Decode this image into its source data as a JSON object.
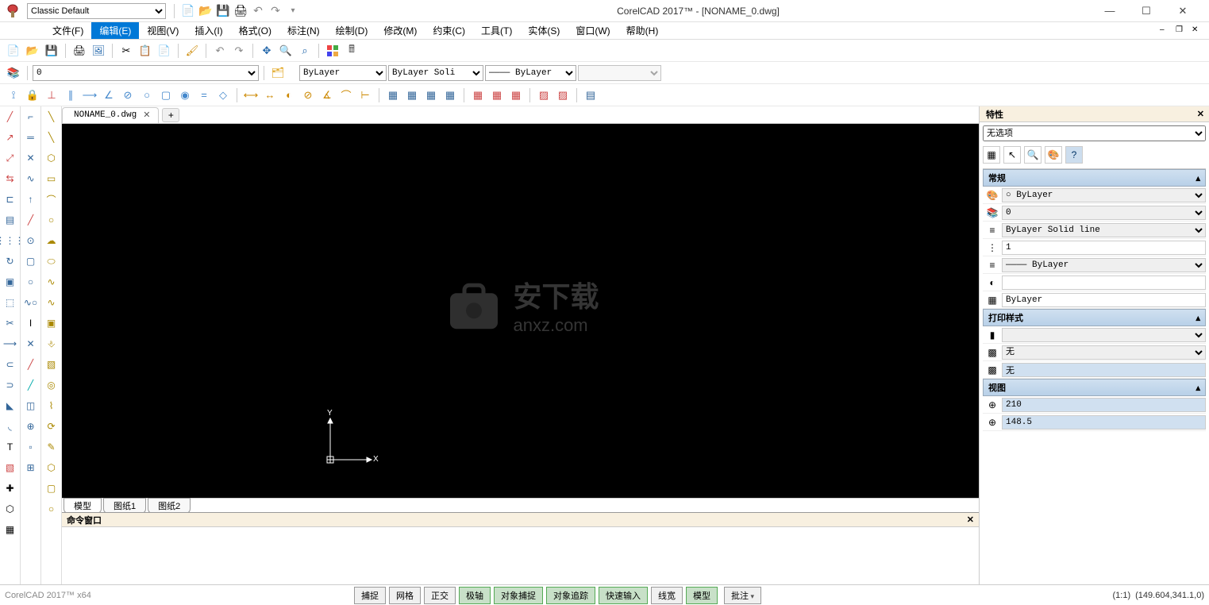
{
  "titlebar": {
    "workspace": "Classic Default",
    "app_title": "CorelCAD 2017™ - [NONAME_0.dwg]"
  },
  "menu": {
    "items": [
      "文件(F)",
      "编辑(E)",
      "视图(V)",
      "插入(I)",
      "格式(O)",
      "标注(N)",
      "绘制(D)",
      "修改(M)",
      "约束(C)",
      "工具(T)",
      "实体(S)",
      "窗口(W)",
      "帮助(H)"
    ],
    "active_index": 1
  },
  "layer_row": {
    "layer_combo": "0",
    "color_combo": "ByLayer",
    "linetype_combo_text": "ByLayer       Soli",
    "lineweight_combo": "———— ByLayer"
  },
  "doc_tabs": {
    "tabs": [
      "NONAME_0.dwg"
    ]
  },
  "sheet_tabs": {
    "tabs": [
      "模型",
      "图纸1",
      "图纸2"
    ],
    "active_index": 0
  },
  "ucs": {
    "x_label": "X",
    "y_label": "Y"
  },
  "cmd_window": {
    "title": "命令窗口"
  },
  "properties": {
    "title": "特性",
    "selection": "无选项",
    "sections": {
      "general": {
        "header": "常规",
        "rows": [
          {
            "icon": "palette",
            "value": "○ ByLayer",
            "type": "select"
          },
          {
            "icon": "layers",
            "value": "0",
            "type": "select"
          },
          {
            "icon": "linetype",
            "value": "ByLayer       Solid line",
            "type": "select"
          },
          {
            "icon": "scale",
            "value": "1",
            "type": "input"
          },
          {
            "icon": "lineweight",
            "value": "———— ByLayer",
            "type": "select"
          },
          {
            "icon": "transparency",
            "value": "",
            "type": "input"
          },
          {
            "icon": "plotstyle-icon",
            "value": "ByLayer",
            "type": "input"
          }
        ]
      },
      "plotstyle": {
        "header": "打印样式",
        "rows": [
          {
            "icon": "colorbar",
            "value": "",
            "type": "select"
          },
          {
            "icon": "plot-toggle",
            "value": "无",
            "type": "select"
          },
          {
            "icon": "plot-toggle2",
            "value": "无",
            "type": "text"
          }
        ]
      },
      "view": {
        "header": "视图",
        "rows": [
          {
            "icon": "view-x",
            "value": "210",
            "type": "input",
            "hl": true
          },
          {
            "icon": "view-y",
            "value": "148.5",
            "type": "input",
            "hl": true
          }
        ]
      }
    }
  },
  "statusbar": {
    "app_label": "CorelCAD 2017™ x64",
    "buttons": [
      {
        "label": "捕捉",
        "active": false
      },
      {
        "label": "网格",
        "active": false
      },
      {
        "label": "正交",
        "active": false
      },
      {
        "label": "极轴",
        "active": true
      },
      {
        "label": "对象捕捉",
        "active": true
      },
      {
        "label": "对象追踪",
        "active": true
      },
      {
        "label": "快速输入",
        "active": true
      },
      {
        "label": "线宽",
        "active": false
      },
      {
        "label": "模型",
        "active": true
      }
    ],
    "annot_label": "批注",
    "ratio": "(1:1)",
    "coords": "(149.604,341.1,0)"
  },
  "watermark": {
    "text": "安下载",
    "sub": "anxz.com"
  }
}
